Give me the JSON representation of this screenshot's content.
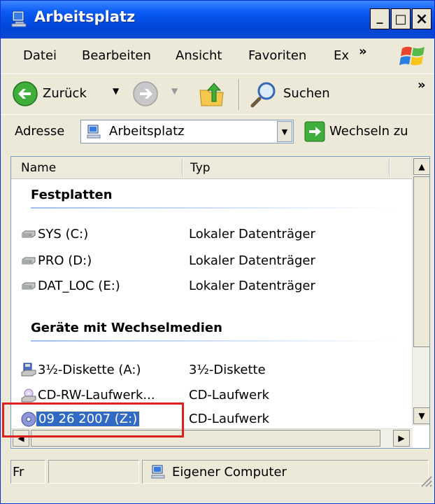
{
  "window": {
    "title": "Arbeitsplatz",
    "buttons": {
      "minimize": "_",
      "maximize": "□",
      "close": "×"
    }
  },
  "menu": {
    "items": [
      "Datei",
      "Bearbeiten",
      "Ansicht",
      "Favoriten",
      "Ex"
    ],
    "overflow": "»"
  },
  "toolbar": {
    "back_label": "Zurück",
    "search_label": "Suchen",
    "overflow": "»"
  },
  "address": {
    "label": "Adresse",
    "value": "Arbeitsplatz",
    "go_label": "Wechseln zu"
  },
  "list": {
    "columns": [
      "Name",
      "Typ"
    ],
    "groups": [
      {
        "title": "Festplatten",
        "items": [
          {
            "name": "SYS (C:)",
            "type": "Lokaler Datenträger",
            "icon": "hard-drive-icon"
          },
          {
            "name": "PRO (D:)",
            "type": "Lokaler Datenträger",
            "icon": "hard-drive-icon"
          },
          {
            "name": "DAT_LOC (E:)",
            "type": "Lokaler Datenträger",
            "icon": "hard-drive-icon"
          }
        ]
      },
      {
        "title": "Geräte mit Wechselmedien",
        "items": [
          {
            "name": "3½-Diskette (A:)",
            "type": "3½-Diskette",
            "icon": "floppy-drive-icon"
          },
          {
            "name": "CD-RW-Laufwerk...",
            "type": "CD-Laufwerk",
            "icon": "cd-drive-icon"
          },
          {
            "name": "09 26 2007 (Z:)",
            "type": "CD-Laufwerk",
            "icon": "cd-disc-icon",
            "selected": true
          }
        ]
      }
    ]
  },
  "status": {
    "left": "Fr",
    "zone": "Eigener Computer"
  },
  "colors": {
    "title_blue": "#0A5BF5",
    "selection": "#316AC5",
    "highlight_box": "#E02020"
  }
}
